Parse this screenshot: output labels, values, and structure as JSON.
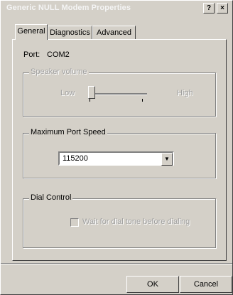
{
  "window": {
    "title": "Generic NULL Modem Properties",
    "help_label": "?",
    "close_label": "×"
  },
  "tabs": [
    {
      "label": "General",
      "active": true
    },
    {
      "label": "Diagnostics",
      "active": false
    },
    {
      "label": "Advanced",
      "active": false
    }
  ],
  "general": {
    "port_label": "Port:",
    "port_value": "COM2",
    "speaker": {
      "legend": "Speaker volume",
      "low_label": "Low",
      "high_label": "High",
      "level": 0
    },
    "speed": {
      "legend": "Maximum Port Speed",
      "value": "115200"
    },
    "dial": {
      "legend": "Dial Control",
      "checkbox_label": "Wait for dial tone before dialing",
      "checked": false
    }
  },
  "footer": {
    "ok_label": "OK",
    "cancel_label": "Cancel"
  },
  "colors": {
    "face": "#d4d0c8",
    "disabled_text": "#a0a0a0"
  }
}
